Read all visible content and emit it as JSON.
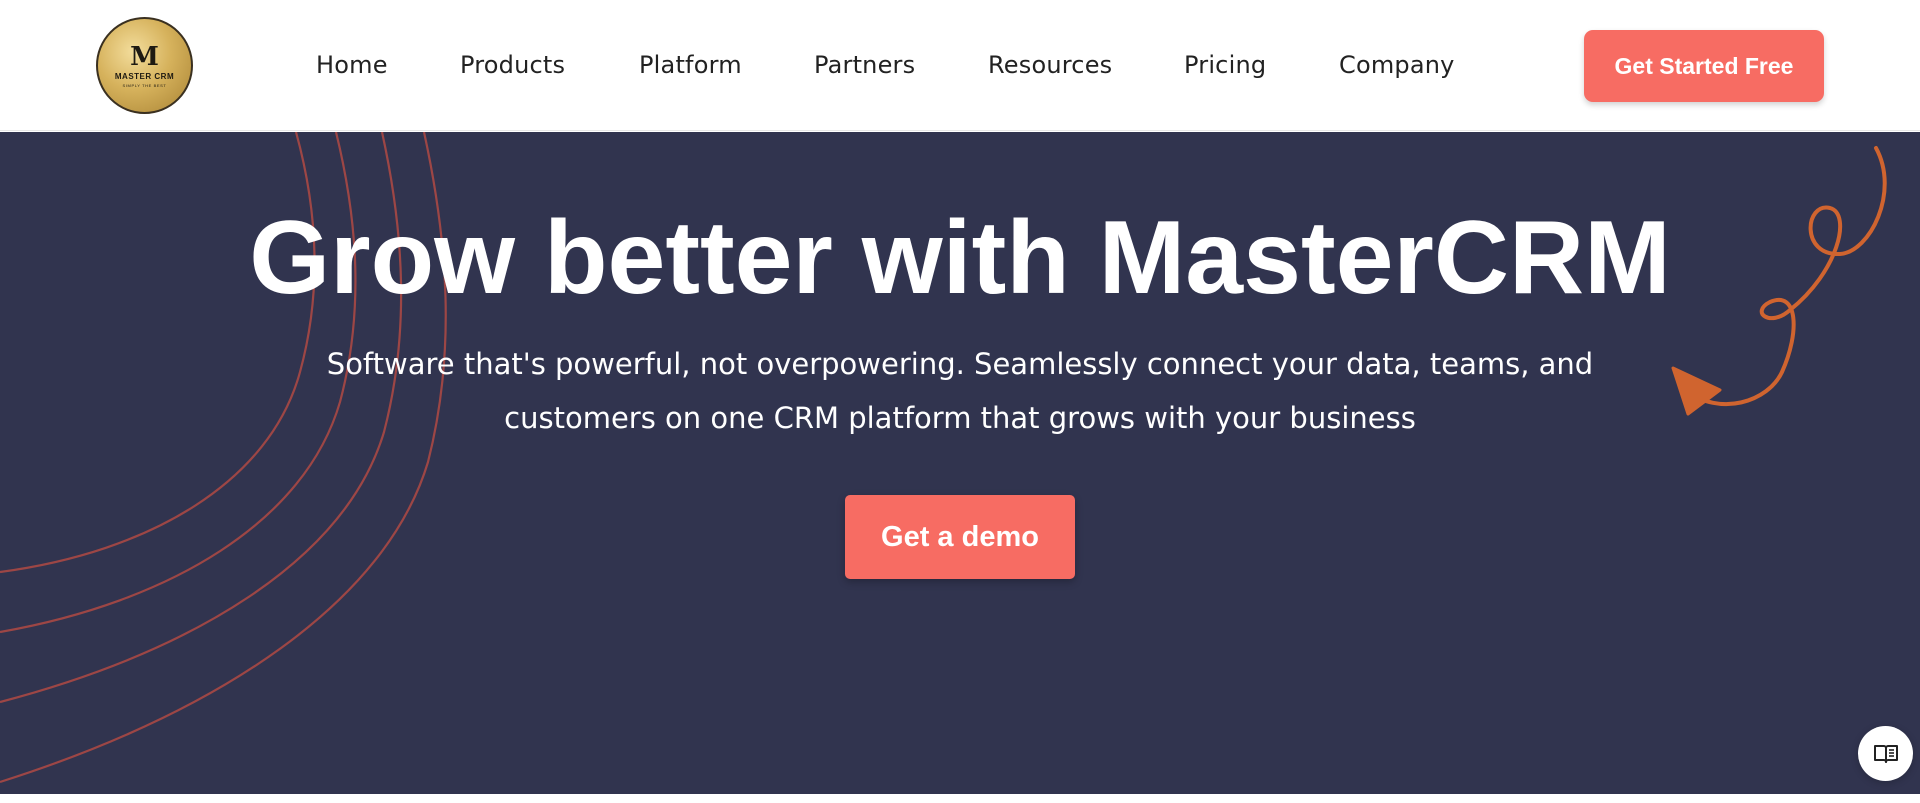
{
  "brand": {
    "logo_mark": "M",
    "logo_name": "MASTER CRM",
    "logo_tagline": "SIMPLY THE BEST"
  },
  "nav": {
    "items": [
      {
        "label": "Home"
      },
      {
        "label": "Products"
      },
      {
        "label": "Platform"
      },
      {
        "label": "Partners"
      },
      {
        "label": "Resources"
      },
      {
        "label": "Pricing"
      },
      {
        "label": "Company"
      }
    ],
    "cta_label": "Get Started Free"
  },
  "hero": {
    "title": "Grow better with MasterCRM",
    "subtitle_line1": "Software that's powerful, not overpowering. Seamlessly connect your data, teams, and",
    "subtitle_line2": "customers on one CRM platform that grows with your business",
    "cta_label": "Get a demo"
  },
  "icons": {
    "reader": "book-reader-icon",
    "arrow": "curly-arrow-icon"
  },
  "colors": {
    "accent": "#f76c63",
    "hero_bg": "#31344f",
    "deco_lines": "#b04a44",
    "arrow": "#d0642f"
  }
}
